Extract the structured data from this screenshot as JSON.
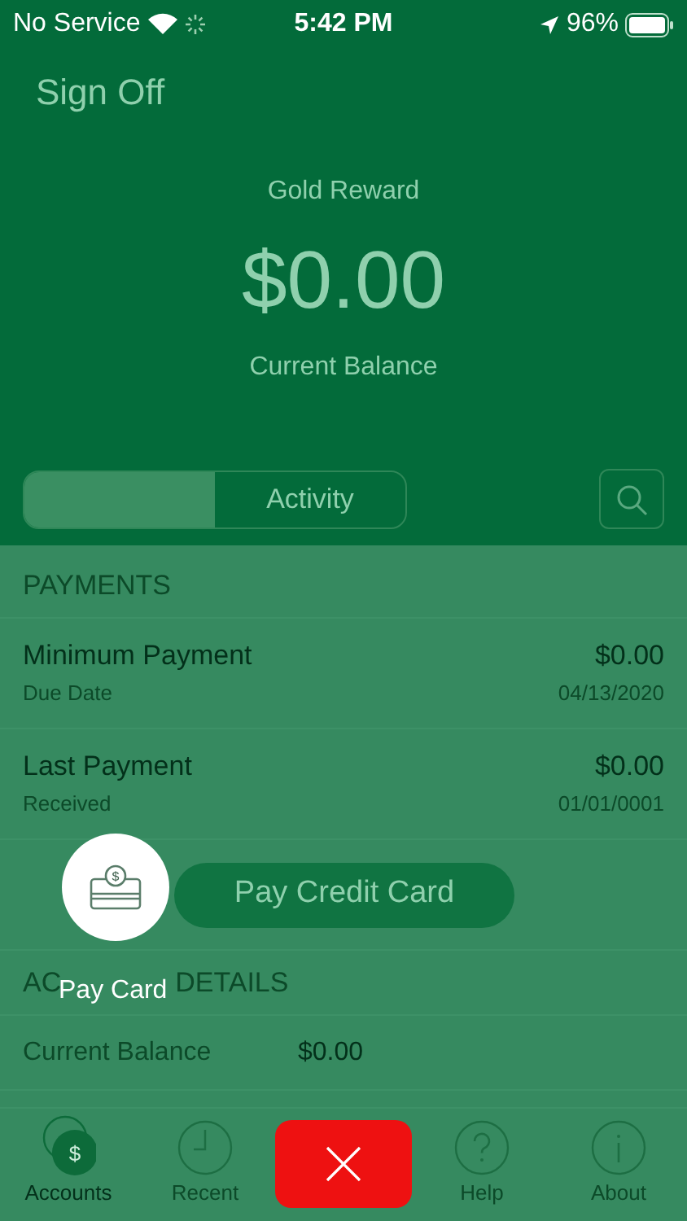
{
  "status_bar": {
    "carrier": "No Service",
    "time": "5:42 PM",
    "battery": "96%"
  },
  "header": {
    "sign_off": "Sign Off",
    "card_name": "Gold Reward",
    "balance": "$0.00",
    "balance_label": "Current Balance"
  },
  "segments": [
    {
      "selected": true
    },
    {
      "label": "Activity",
      "selected": false
    }
  ],
  "payments": {
    "heading": "PAYMENTS",
    "rows": [
      {
        "title": "Minimum Payment",
        "subtitle": "Due Date",
        "amount": "$0.00",
        "date": "04/13/2020"
      },
      {
        "title": "Last Payment",
        "subtitle": "Received",
        "amount": "$0.00",
        "date": "01/01/0001"
      }
    ],
    "pay_button": "Pay Credit Card"
  },
  "account_details": {
    "heading_parts": [
      "AC",
      "DETAILS"
    ],
    "rows": [
      {
        "label": "Current Balance",
        "value": "$0.00"
      }
    ]
  },
  "tab_bar": [
    {
      "kind": "accounts",
      "label": "Accounts",
      "icon_symbol": "$",
      "selected": true
    },
    {
      "kind": "recent",
      "label": "Recent",
      "selected": false
    },
    {
      "kind": "help",
      "label": "Help",
      "selected": false
    },
    {
      "kind": "about",
      "label": "About",
      "selected": false
    }
  ],
  "overlay": {
    "action_label": "Pay Card",
    "icon_symbol": "$"
  }
}
